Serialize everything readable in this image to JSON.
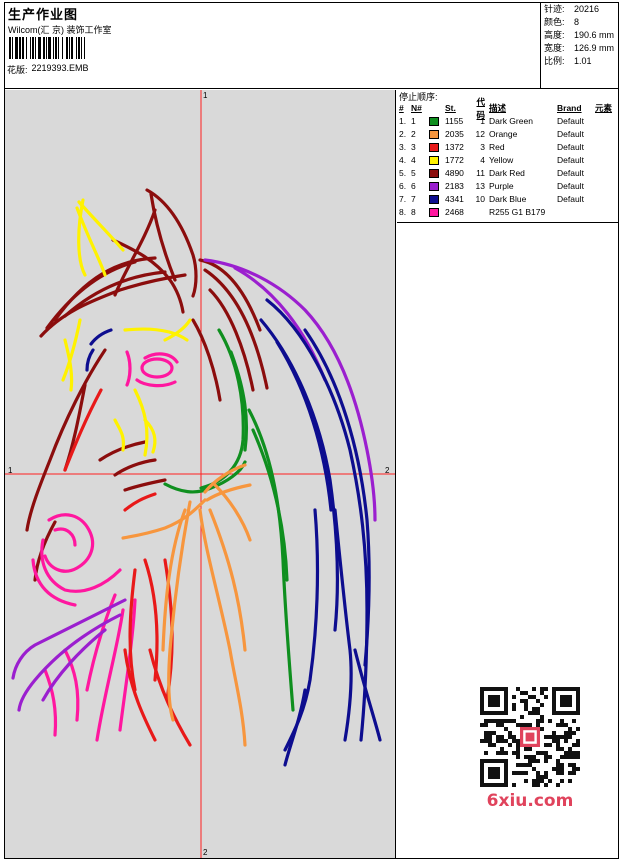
{
  "header": {
    "title": "生产作业图",
    "studio": "Wilcom(汇 京) 装饰工作室",
    "pattern_label": "花版:",
    "pattern_value": "2219393.EMB"
  },
  "stats": [
    {
      "label": "针迹:",
      "value": "20216"
    },
    {
      "label": "颜色:",
      "value": "8"
    },
    {
      "label": "高度:",
      "value": "190.6 mm"
    },
    {
      "label": "宽度:",
      "value": "126.9 mm"
    },
    {
      "label": "比例:",
      "value": "1.01"
    }
  ],
  "axes": {
    "top": "1",
    "left": "1",
    "right": "2",
    "bottom": "2"
  },
  "stop_sequence_title": "停止顺序:",
  "table_headers": {
    "num": "#",
    "n": "N#",
    "st": "St.",
    "code": "代码",
    "desc": "描述",
    "brand": "Brand",
    "element": "元素"
  },
  "colors": [
    {
      "num": "1.",
      "n": "1",
      "swatch": "#0f8f1f",
      "st": "1155",
      "code": "1",
      "desc": "Dark Green",
      "brand": "Default"
    },
    {
      "num": "2.",
      "n": "2",
      "swatch": "#f7963e",
      "st": "2035",
      "code": "12",
      "desc": "Orange",
      "brand": "Default"
    },
    {
      "num": "3.",
      "n": "3",
      "swatch": "#e81919",
      "st": "1372",
      "code": "3",
      "desc": "Red",
      "brand": "Default"
    },
    {
      "num": "4.",
      "n": "4",
      "swatch": "#fff200",
      "st": "1772",
      "code": "4",
      "desc": "Yellow",
      "brand": "Default"
    },
    {
      "num": "5.",
      "n": "5",
      "swatch": "#8b0d0d",
      "st": "4890",
      "code": "11",
      "desc": "Dark Red",
      "brand": "Default"
    },
    {
      "num": "6.",
      "n": "6",
      "swatch": "#9b1fcf",
      "st": "2183",
      "code": "13",
      "desc": "Purple",
      "brand": "Default"
    },
    {
      "num": "7.",
      "n": "7",
      "swatch": "#0d0d8f",
      "st": "4341",
      "code": "10",
      "desc": "Dark Blue",
      "brand": "Default"
    },
    {
      "num": "8.",
      "n": "8",
      "swatch": "#ff179f",
      "st": "2468",
      "code": "",
      "desc": "R255 G1 B179",
      "brand": ""
    }
  ],
  "watermark": {
    "site": "6xiu.com"
  }
}
